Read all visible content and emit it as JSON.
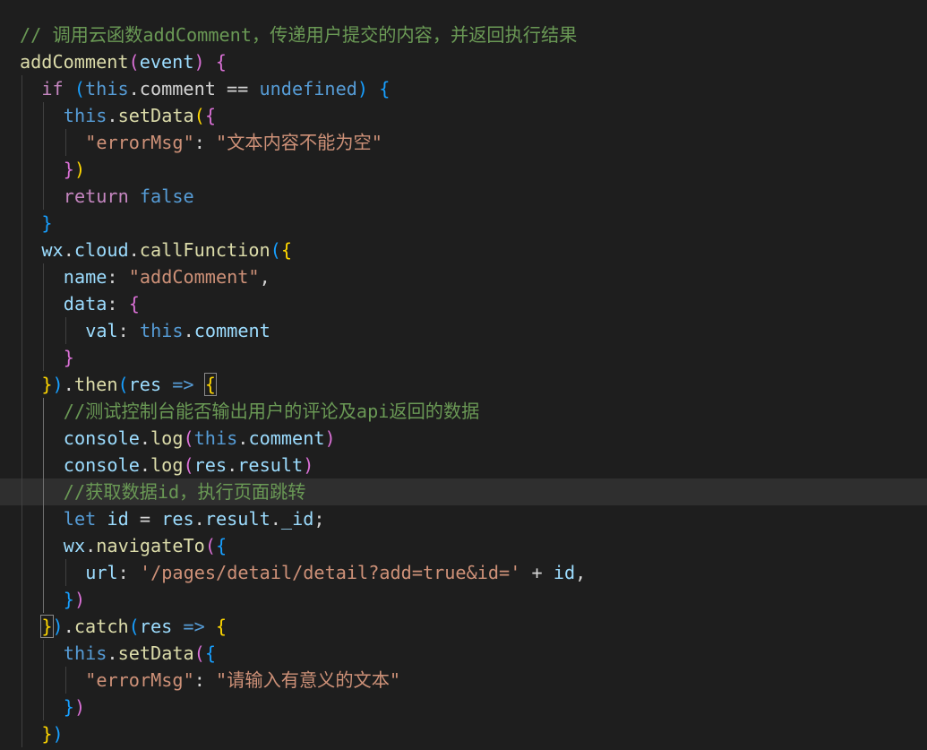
{
  "editor": {
    "colors": {
      "background": "#1e1e1e",
      "current_line": "#2f2f2f",
      "comment": "#6a9955",
      "keyword": "#569cd6",
      "control": "#c586c0",
      "function": "#dcdcaa",
      "string": "#ce9178",
      "property": "#9cdcfe",
      "plain": "#d4d4d4",
      "bracket_gold": "#ffd700",
      "bracket_pink": "#da70d6",
      "bracket_blue": "#179fff"
    },
    "highlighted_line": 17,
    "lines": [
      {
        "indent": 0,
        "tokens": [
          {
            "t": "// 调用云函数addComment，传递用户提交的内容，并返回执行结果",
            "c": "#6a9955"
          }
        ]
      },
      {
        "indent": 0,
        "tokens": [
          {
            "t": "addComment",
            "c": "#dcdcaa"
          },
          {
            "t": "(",
            "c": "#da70d6"
          },
          {
            "t": "event",
            "c": "#9cdcfe"
          },
          {
            "t": ")",
            "c": "#da70d6"
          },
          {
            "t": " ",
            "c": "#d4d4d4"
          },
          {
            "t": "{",
            "c": "#da70d6"
          }
        ]
      },
      {
        "indent": 1,
        "tokens": [
          {
            "t": "if",
            "c": "#c586c0"
          },
          {
            "t": " ",
            "c": "#d4d4d4"
          },
          {
            "t": "(",
            "c": "#179fff"
          },
          {
            "t": "this",
            "c": "#569cd6"
          },
          {
            "t": ".comment ",
            "c": "#d4d4d4"
          },
          {
            "t": "==",
            "c": "#d4d4d4"
          },
          {
            "t": " ",
            "c": "#d4d4d4"
          },
          {
            "t": "undefined",
            "c": "#569cd6"
          },
          {
            "t": ")",
            "c": "#179fff"
          },
          {
            "t": " ",
            "c": "#d4d4d4"
          },
          {
            "t": "{",
            "c": "#179fff"
          }
        ]
      },
      {
        "indent": 2,
        "tokens": [
          {
            "t": "this",
            "c": "#569cd6"
          },
          {
            "t": ".",
            "c": "#d4d4d4"
          },
          {
            "t": "setData",
            "c": "#dcdcaa"
          },
          {
            "t": "(",
            "c": "#ffd700"
          },
          {
            "t": "{",
            "c": "#da70d6"
          }
        ]
      },
      {
        "indent": 3,
        "tokens": [
          {
            "t": "\"errorMsg\"",
            "c": "#ce9178"
          },
          {
            "t": ": ",
            "c": "#d4d4d4"
          },
          {
            "t": "\"文本内容不能为空\"",
            "c": "#ce9178"
          }
        ]
      },
      {
        "indent": 2,
        "tokens": [
          {
            "t": "}",
            "c": "#da70d6"
          },
          {
            "t": ")",
            "c": "#ffd700"
          }
        ]
      },
      {
        "indent": 2,
        "tokens": [
          {
            "t": "return",
            "c": "#c586c0"
          },
          {
            "t": " ",
            "c": "#d4d4d4"
          },
          {
            "t": "false",
            "c": "#569cd6"
          }
        ]
      },
      {
        "indent": 1,
        "tokens": [
          {
            "t": "}",
            "c": "#179fff"
          }
        ]
      },
      {
        "indent": 1,
        "tokens": [
          {
            "t": "wx",
            "c": "#9cdcfe"
          },
          {
            "t": ".",
            "c": "#d4d4d4"
          },
          {
            "t": "cloud",
            "c": "#9cdcfe"
          },
          {
            "t": ".",
            "c": "#d4d4d4"
          },
          {
            "t": "callFunction",
            "c": "#dcdcaa"
          },
          {
            "t": "(",
            "c": "#179fff"
          },
          {
            "t": "{",
            "c": "#ffd700"
          }
        ]
      },
      {
        "indent": 2,
        "tokens": [
          {
            "t": "name",
            "c": "#9cdcfe"
          },
          {
            "t": ": ",
            "c": "#d4d4d4"
          },
          {
            "t": "\"addComment\"",
            "c": "#ce9178"
          },
          {
            "t": ",",
            "c": "#d4d4d4"
          }
        ]
      },
      {
        "indent": 2,
        "tokens": [
          {
            "t": "data",
            "c": "#9cdcfe"
          },
          {
            "t": ": ",
            "c": "#d4d4d4"
          },
          {
            "t": "{",
            "c": "#da70d6"
          }
        ]
      },
      {
        "indent": 3,
        "tokens": [
          {
            "t": "val",
            "c": "#9cdcfe"
          },
          {
            "t": ": ",
            "c": "#d4d4d4"
          },
          {
            "t": "this",
            "c": "#569cd6"
          },
          {
            "t": ".",
            "c": "#d4d4d4"
          },
          {
            "t": "comment",
            "c": "#9cdcfe"
          }
        ]
      },
      {
        "indent": 2,
        "tokens": [
          {
            "t": "}",
            "c": "#da70d6"
          }
        ]
      },
      {
        "indent": 1,
        "tokens": [
          {
            "t": "}",
            "c": "#ffd700"
          },
          {
            "t": ")",
            "c": "#179fff"
          },
          {
            "t": ".",
            "c": "#d4d4d4"
          },
          {
            "t": "then",
            "c": "#dcdcaa"
          },
          {
            "t": "(",
            "c": "#179fff"
          },
          {
            "t": "res",
            "c": "#9cdcfe"
          },
          {
            "t": " ",
            "c": "#d4d4d4"
          },
          {
            "t": "=>",
            "c": "#569cd6"
          },
          {
            "t": " ",
            "c": "#d4d4d4"
          },
          {
            "t": "{",
            "c": "#ffd700",
            "boxed": true
          }
        ]
      },
      {
        "indent": 2,
        "tokens": [
          {
            "t": "//测试控制台能否输出用户的评论及api返回的数据",
            "c": "#6a9955"
          }
        ]
      },
      {
        "indent": 2,
        "tokens": [
          {
            "t": "console",
            "c": "#9cdcfe"
          },
          {
            "t": ".",
            "c": "#d4d4d4"
          },
          {
            "t": "log",
            "c": "#dcdcaa"
          },
          {
            "t": "(",
            "c": "#da70d6"
          },
          {
            "t": "this",
            "c": "#569cd6"
          },
          {
            "t": ".",
            "c": "#d4d4d4"
          },
          {
            "t": "comment",
            "c": "#9cdcfe"
          },
          {
            "t": ")",
            "c": "#da70d6"
          }
        ]
      },
      {
        "indent": 2,
        "tokens": [
          {
            "t": "console",
            "c": "#9cdcfe"
          },
          {
            "t": ".",
            "c": "#d4d4d4"
          },
          {
            "t": "log",
            "c": "#dcdcaa"
          },
          {
            "t": "(",
            "c": "#da70d6"
          },
          {
            "t": "res",
            "c": "#9cdcfe"
          },
          {
            "t": ".",
            "c": "#d4d4d4"
          },
          {
            "t": "result",
            "c": "#9cdcfe"
          },
          {
            "t": ")",
            "c": "#da70d6"
          }
        ]
      },
      {
        "indent": 2,
        "tokens": [
          {
            "t": "//获取数据id，执行页面跳转",
            "c": "#6a9955"
          }
        ]
      },
      {
        "indent": 2,
        "tokens": [
          {
            "t": "let",
            "c": "#569cd6"
          },
          {
            "t": " ",
            "c": "#d4d4d4"
          },
          {
            "t": "id",
            "c": "#9cdcfe"
          },
          {
            "t": " = ",
            "c": "#d4d4d4"
          },
          {
            "t": "res",
            "c": "#9cdcfe"
          },
          {
            "t": ".",
            "c": "#d4d4d4"
          },
          {
            "t": "result",
            "c": "#9cdcfe"
          },
          {
            "t": ".",
            "c": "#d4d4d4"
          },
          {
            "t": "_id",
            "c": "#9cdcfe"
          },
          {
            "t": ";",
            "c": "#d4d4d4"
          }
        ]
      },
      {
        "indent": 2,
        "tokens": [
          {
            "t": "wx",
            "c": "#9cdcfe"
          },
          {
            "t": ".",
            "c": "#d4d4d4"
          },
          {
            "t": "navigateTo",
            "c": "#dcdcaa"
          },
          {
            "t": "(",
            "c": "#da70d6"
          },
          {
            "t": "{",
            "c": "#179fff"
          }
        ]
      },
      {
        "indent": 3,
        "tokens": [
          {
            "t": "url",
            "c": "#9cdcfe"
          },
          {
            "t": ": ",
            "c": "#d4d4d4"
          },
          {
            "t": "'/pages/detail/detail?add=true&id='",
            "c": "#ce9178"
          },
          {
            "t": " + ",
            "c": "#d4d4d4"
          },
          {
            "t": "id",
            "c": "#9cdcfe"
          },
          {
            "t": ",",
            "c": "#d4d4d4"
          }
        ]
      },
      {
        "indent": 2,
        "tokens": [
          {
            "t": "}",
            "c": "#179fff"
          },
          {
            "t": ")",
            "c": "#da70d6"
          }
        ]
      },
      {
        "indent": 1,
        "tokens": [
          {
            "t": "}",
            "c": "#ffd700",
            "boxed": true
          },
          {
            "t": ")",
            "c": "#179fff"
          },
          {
            "t": ".",
            "c": "#d4d4d4"
          },
          {
            "t": "catch",
            "c": "#dcdcaa"
          },
          {
            "t": "(",
            "c": "#179fff"
          },
          {
            "t": "res",
            "c": "#9cdcfe"
          },
          {
            "t": " ",
            "c": "#d4d4d4"
          },
          {
            "t": "=>",
            "c": "#569cd6"
          },
          {
            "t": " ",
            "c": "#d4d4d4"
          },
          {
            "t": "{",
            "c": "#ffd700"
          }
        ]
      },
      {
        "indent": 2,
        "tokens": [
          {
            "t": "this",
            "c": "#569cd6"
          },
          {
            "t": ".",
            "c": "#d4d4d4"
          },
          {
            "t": "setData",
            "c": "#dcdcaa"
          },
          {
            "t": "(",
            "c": "#da70d6"
          },
          {
            "t": "{",
            "c": "#179fff"
          }
        ]
      },
      {
        "indent": 3,
        "tokens": [
          {
            "t": "\"errorMsg\"",
            "c": "#ce9178"
          },
          {
            "t": ": ",
            "c": "#d4d4d4"
          },
          {
            "t": "\"请输入有意义的文本\"",
            "c": "#ce9178"
          }
        ]
      },
      {
        "indent": 2,
        "tokens": [
          {
            "t": "}",
            "c": "#179fff"
          },
          {
            "t": ")",
            "c": "#da70d6"
          }
        ]
      },
      {
        "indent": 1,
        "tokens": [
          {
            "t": "}",
            "c": "#ffd700"
          },
          {
            "t": ")",
            "c": "#179fff"
          }
        ]
      }
    ]
  }
}
